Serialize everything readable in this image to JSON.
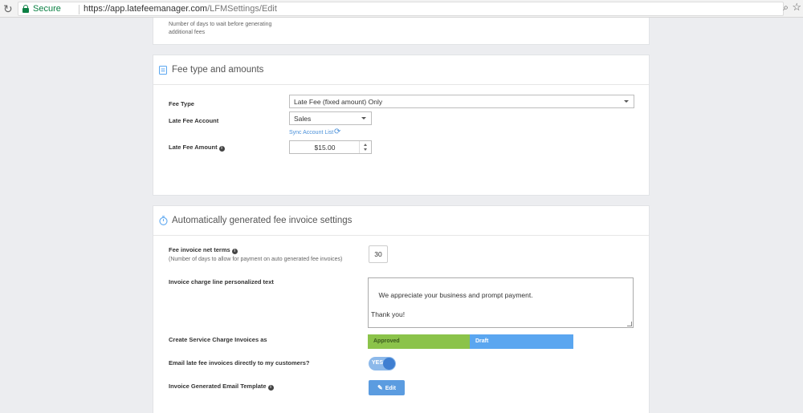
{
  "browser": {
    "secure_label": "Secure",
    "url_host": "https://app.latefeemanager.com",
    "url_path": "/LFMSettings/Edit",
    "icons": [
      "reload-icon",
      "lock-icon",
      "zoom-icon",
      "star-icon"
    ]
  },
  "top_card": {
    "help_text": "Number of days to wait before generating\nadditional fees"
  },
  "fee_section": {
    "title": "Fee type and amounts",
    "icon": "document-icon",
    "fee_type_label": "Fee Type",
    "fee_type_value": "Late Fee (fixed amount) Only",
    "account_label": "Late Fee Account",
    "account_value": "Sales",
    "sync_link": "Sync Account List",
    "amount_label": "Late Fee Amount",
    "amount_value": "$15.00"
  },
  "invoice_section": {
    "title": "Automatically generated fee invoice settings",
    "icon": "stopwatch-icon",
    "net_terms_label": "Fee invoice net terms",
    "net_terms_help": "(Number of days to allow for payment on auto generated fee invoices)",
    "net_terms_value": "30",
    "charge_text_label": "Invoice charge line personalized text",
    "charge_text_value": "We appreciate your business and prompt payment.\n\nThank you!",
    "create_as_label": "Create Service Charge Invoices as",
    "option_approved": "Approved",
    "option_draft": "Draft",
    "email_label": "Email late fee invoices directly to my customers?",
    "email_toggle": "YES",
    "template_label": "Invoice Generated Email Template",
    "edit_button": "Edit"
  },
  "colors": {
    "approved": "#8bc34a",
    "draft": "#5aa6f0",
    "link": "#4a90d9",
    "secure": "#0b8043"
  }
}
